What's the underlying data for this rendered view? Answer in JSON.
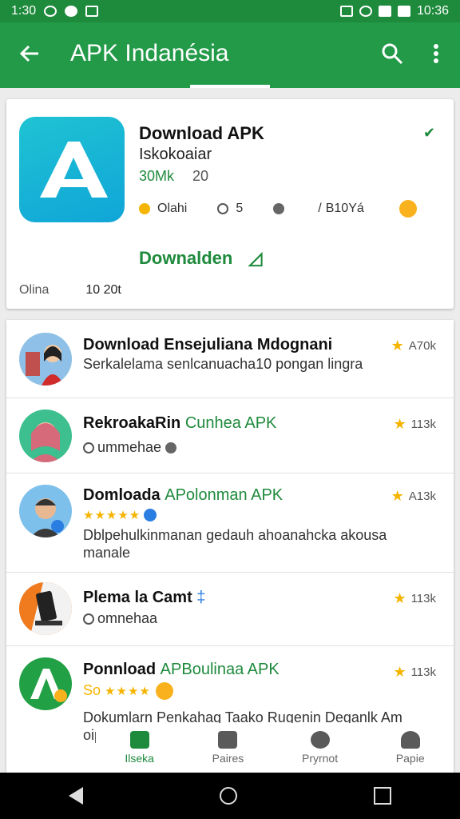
{
  "status": {
    "time": "1:30",
    "clock": "10:36"
  },
  "app_bar": {
    "title": "APK Indanésia"
  },
  "hero": {
    "name": "Download APK",
    "developer": "Iskokoaiar",
    "size": "30Mk",
    "version": "20",
    "stats": [
      "Olahi",
      "5",
      "",
      "B10Yá"
    ],
    "download_label": "Downalden",
    "sub_left": "Olina",
    "sub_right": "10 20t"
  },
  "list": [
    {
      "title": "Download Ensejuliana Mdognani",
      "desc": "Serkalelama senlcanuacha10 pongan lingra",
      "rating": "A70k"
    },
    {
      "title": "RekroakaRin",
      "title_green": "Cunhea APK",
      "meta": "ummehae",
      "rating": "113k"
    },
    {
      "title": "Domloada",
      "title_green": "APolonman APK",
      "desc": "Dblpehulkinmanan gedauh ahoanahcka akousa manale",
      "rating": "A13k"
    },
    {
      "title": "Plema la Camt",
      "meta": "omnehaa",
      "rating": "113k"
    },
    {
      "title": "Ponnload",
      "title_green": "APBoulinaa APK",
      "meta": "So",
      "desc": "Dokumlarn Penkahag Taako Rugenin Deganlk Am oipert",
      "rating": "113k"
    }
  ],
  "bottom_nav": [
    {
      "label": "Ilseka"
    },
    {
      "label": "Paires"
    },
    {
      "label": "Pryrnot"
    },
    {
      "label": "Papie"
    }
  ],
  "colors": {
    "primary": "#239a48",
    "status": "#1e8a3c",
    "star": "#f5b400"
  }
}
